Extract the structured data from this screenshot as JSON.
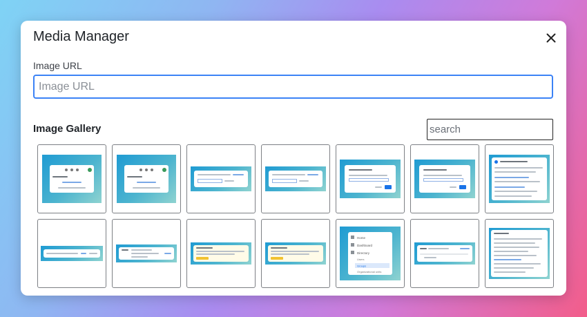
{
  "modal": {
    "title": "Media Manager",
    "close_icon": "close-icon"
  },
  "url_field": {
    "label": "Image URL",
    "placeholder": "Image URL",
    "value": ""
  },
  "gallery": {
    "title": "Image Gallery",
    "search_placeholder": "search",
    "thumbnail_count": 14,
    "thumbnail_sidebar_labels": [
      "Home",
      "Dashboard",
      "Directory",
      "Users",
      "Groups",
      "Organizational units"
    ]
  },
  "colors": {
    "accent": "#3b82f6",
    "thumbnail_background": "#1f9bd3",
    "button_blue": "#1a73e8",
    "warning_yellow": "#f2c230"
  }
}
